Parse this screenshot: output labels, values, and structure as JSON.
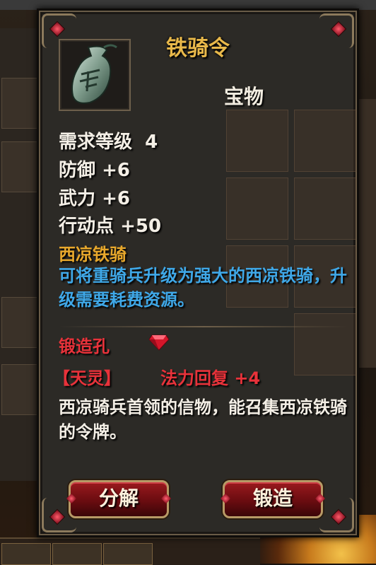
{
  "item": {
    "name": "铁骑令",
    "category": "宝物",
    "stats": [
      {
        "label": "需求等级",
        "value": "4"
      },
      {
        "label": "防御",
        "value": "+6"
      },
      {
        "label": "武力",
        "value": "+6"
      },
      {
        "label": "行动点",
        "value": "+50"
      }
    ],
    "set_name": "西凉铁骑",
    "effect_desc": "可将重骑兵升级为强大的西凉铁骑，升级需要耗费资源。",
    "socket_label": "锻造孔",
    "socket_gem": "ruby-icon",
    "rune": "【天灵】",
    "rune_effect": "法力回复 +4",
    "lore": "西凉骑兵首领的信物，能召集西凉铁骑的令牌。"
  },
  "buttons": {
    "decompose": "分解",
    "forge": "锻造"
  },
  "colors": {
    "title": "#e8b84a",
    "set_name": "#e8a82c",
    "effect": "#3fa8e8",
    "socket": "#e8323a",
    "text": "#f4efe6",
    "button": "#8a1418"
  }
}
